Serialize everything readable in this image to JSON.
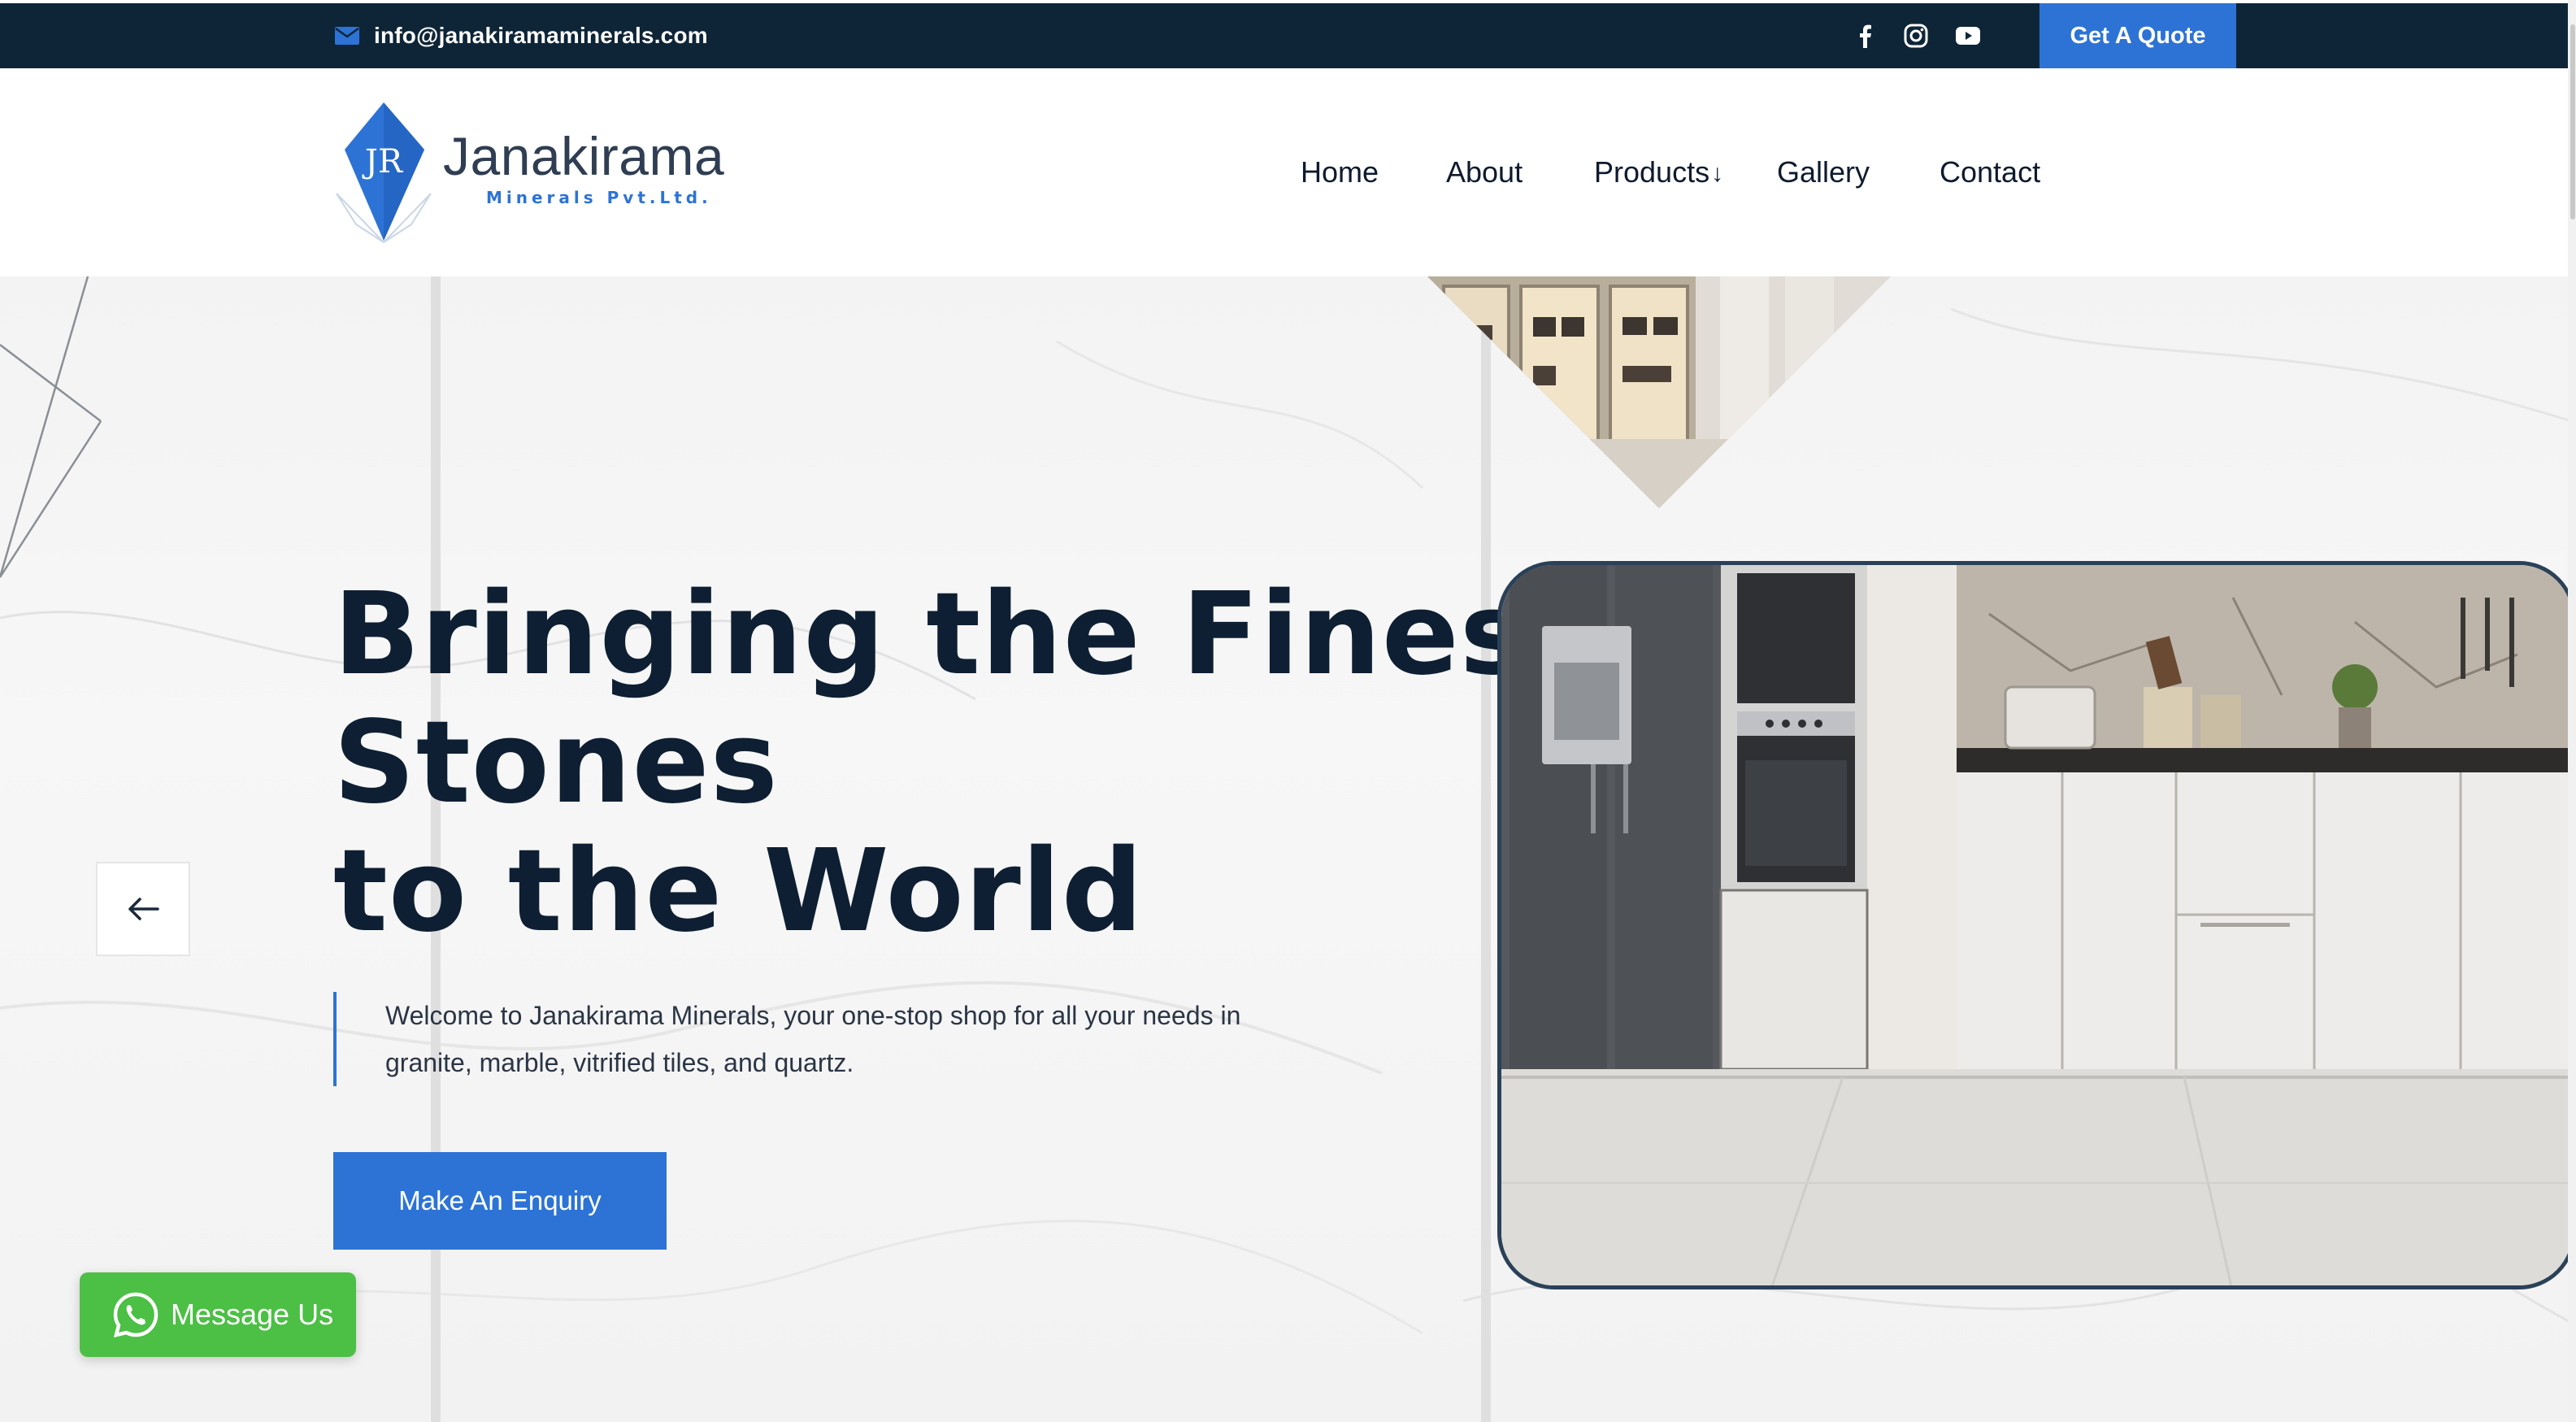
{
  "topbar": {
    "email": "info@janakiramaminerals.com",
    "icons": [
      "mail-icon",
      "facebook-icon",
      "instagram-icon",
      "youtube-icon"
    ],
    "quote_label": "Get A Quote"
  },
  "logo": {
    "name": "Janakirama",
    "subtitle": "Minerals Pvt.Ltd.",
    "monogram": "JR"
  },
  "nav": {
    "home": "Home",
    "about": "About",
    "products": "Products",
    "products_caret": "↓",
    "gallery": "Gallery",
    "contact": "Contact"
  },
  "hero": {
    "title_line1": "Bringing the Finest",
    "title_line2": "Stones",
    "title_line3": "to the World",
    "description": "Welcome to Janakirama Minerals, your one-stop shop for all your needs in granite, marble, vitrified tiles, and quartz.",
    "cta_label": "Make An Enquiry",
    "prev_icon": "arrow-left-icon",
    "next_icon": "arrow-right-icon"
  },
  "whatsapp": {
    "label": "Message Us",
    "icon": "whatsapp-icon"
  },
  "colors": {
    "topbar_bg": "#0e2537",
    "accent": "#2d73d5",
    "heading": "#0e1f33",
    "whatsapp": "#4cbf45"
  }
}
